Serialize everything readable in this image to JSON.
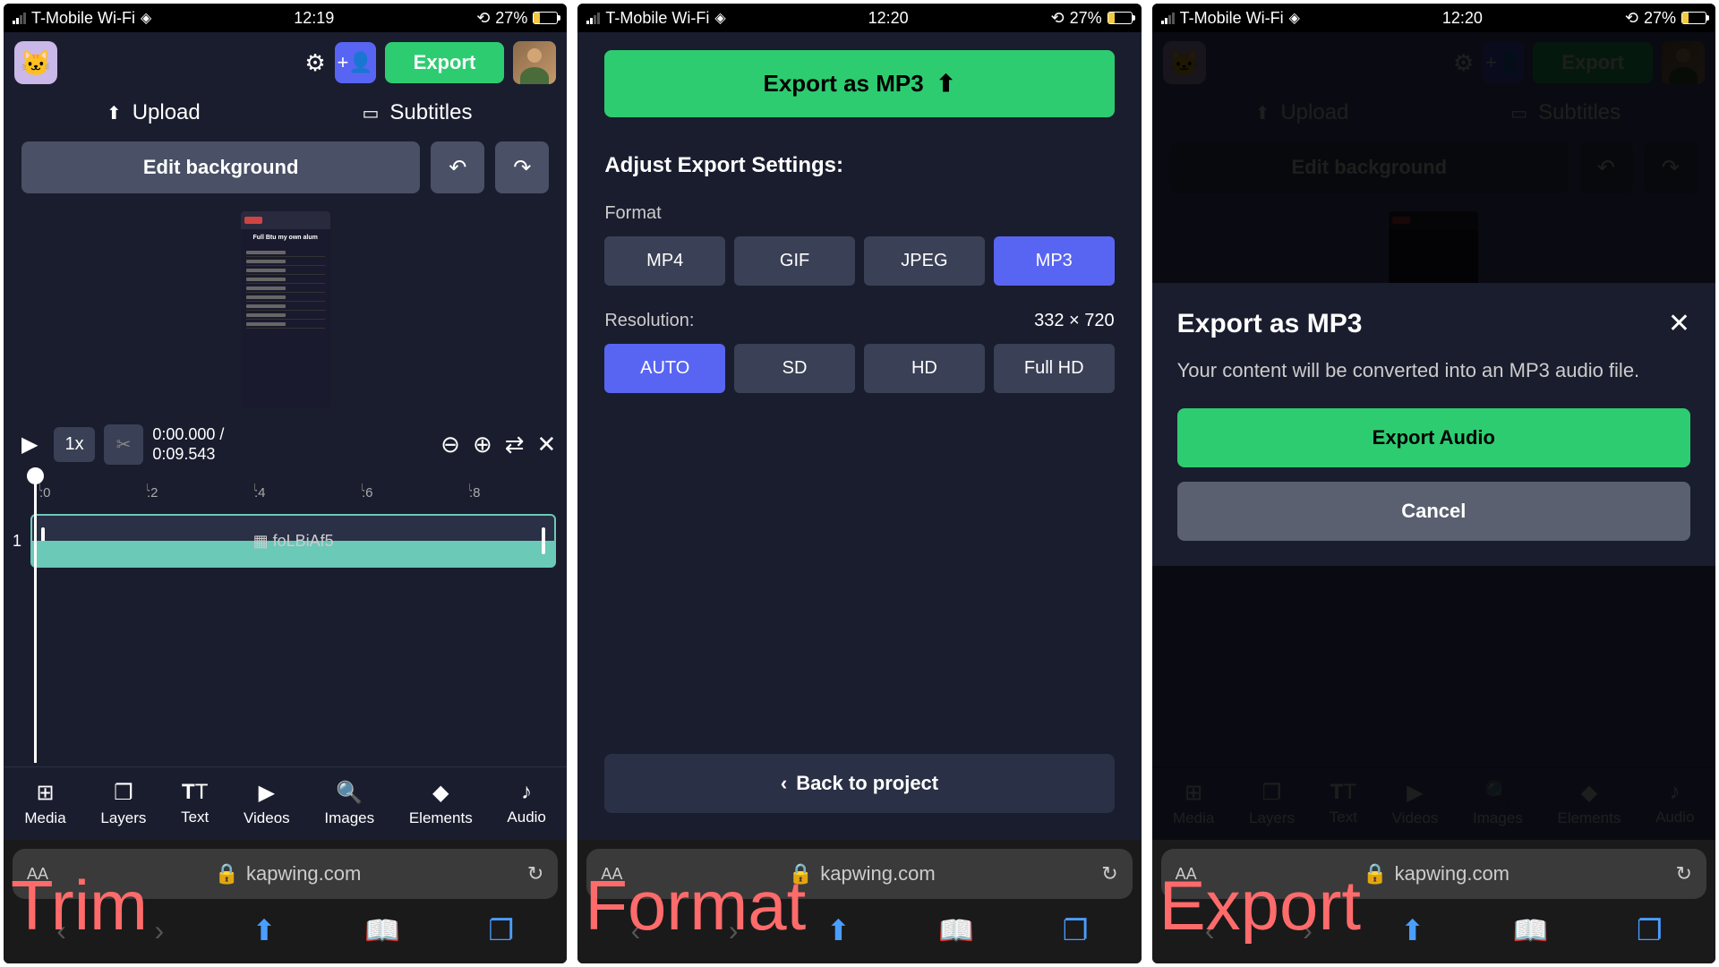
{
  "status_bar": {
    "carrier": "T-Mobile Wi-Fi",
    "time1": "12:19",
    "time2": "12:20",
    "time3": "12:20",
    "battery_pct": "27%"
  },
  "phone1": {
    "export_label": "Export",
    "upload_label": "Upload",
    "subtitles_label": "Subtitles",
    "edit_bg_label": "Edit background",
    "speed_label": "1x",
    "time_current": "0:00.000 /",
    "time_total": "0:09.543",
    "ruler": [
      ":0",
      ":2",
      ":4",
      ":6",
      ":8"
    ],
    "clip_name": "foLBiAf5",
    "track_num": "1",
    "tools": [
      "Media",
      "Layers",
      "Text",
      "Videos",
      "Images",
      "Elements",
      "Audio"
    ],
    "preview_caption": "Full Btu my own alum"
  },
  "phone2": {
    "export_as_label": "Export as MP3",
    "settings_title": "Adjust Export Settings:",
    "format_label": "Format",
    "formats": [
      "MP4",
      "GIF",
      "JPEG",
      "MP3"
    ],
    "resolution_label": "Resolution:",
    "resolution_value": "332 × 720",
    "resolutions": [
      "AUTO",
      "SD",
      "HD",
      "Full HD"
    ],
    "back_label": "Back to project"
  },
  "phone3": {
    "modal_title": "Export as MP3",
    "modal_desc": "Your content will be converted into an MP3 audio file.",
    "confirm_label": "Export Audio",
    "cancel_label": "Cancel"
  },
  "browser": {
    "url": "kapwing.com",
    "aa_label": "AA"
  },
  "labels": {
    "trim": "Trim",
    "format": "Format",
    "export": "Export"
  }
}
